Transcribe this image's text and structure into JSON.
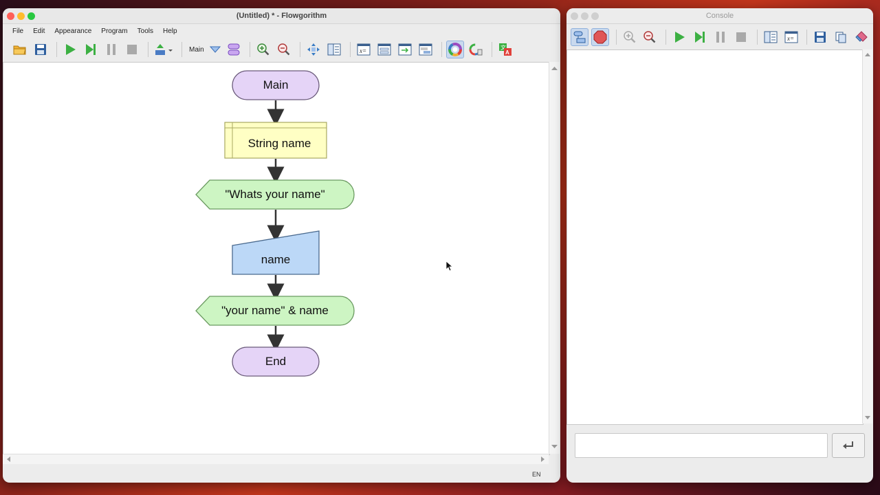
{
  "editor": {
    "title": "(Untitled) * - Flowgorithm",
    "menu": [
      "File",
      "Edit",
      "Appearance",
      "Program",
      "Tools",
      "Help"
    ],
    "function_selector": "Main",
    "status_lang": "EN"
  },
  "flowchart": {
    "start": "Main",
    "declare": "String name",
    "output1": "\"Whats your name\"",
    "input": "name",
    "output2": "\"your name\" & name",
    "end": "End"
  },
  "console": {
    "title": "Console",
    "input_value": ""
  },
  "colors": {
    "terminal_fill": "#e5d4f7",
    "declare_fill": "#ffffc4",
    "output_fill": "#cdf5c3",
    "input_fill": "#bcd8f7",
    "active_toolbar": "#c9d9ee"
  }
}
